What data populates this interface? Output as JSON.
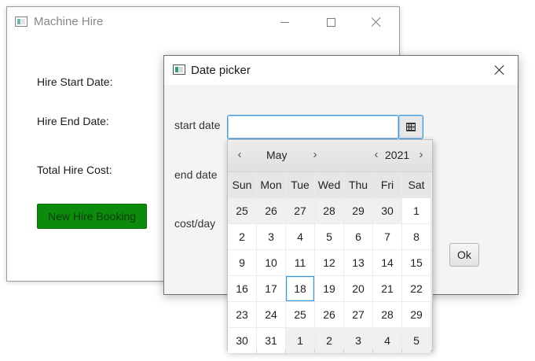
{
  "main_window": {
    "title": "Machine Hire",
    "labels": {
      "hire_start": "Hire Start Date:",
      "hire_end": "Hire End Date:",
      "total_cost": "Total Hire Cost:"
    },
    "new_booking_button": "New Hire Booking",
    "button_color": "#0b8a0b"
  },
  "dialog": {
    "title": "Date picker",
    "start_label": "start date",
    "end_label": "end date",
    "cost_label": "cost/day",
    "start_value": "",
    "ok_button": "Ok",
    "focus_color": "#3a9ad9"
  },
  "picker": {
    "month": "May",
    "year": "2021",
    "today": "18",
    "weekdays": [
      "Sun",
      "Mon",
      "Tue",
      "Wed",
      "Thu",
      "Fri",
      "Sat"
    ],
    "weeks": [
      [
        "25",
        "26",
        "27",
        "28",
        "29",
        "30",
        "1"
      ],
      [
        "2",
        "3",
        "4",
        "5",
        "6",
        "7",
        "8"
      ],
      [
        "9",
        "10",
        "11",
        "12",
        "13",
        "14",
        "15"
      ],
      [
        "16",
        "17",
        "18",
        "19",
        "20",
        "21",
        "22"
      ],
      [
        "23",
        "24",
        "25",
        "26",
        "27",
        "28",
        "29"
      ],
      [
        "30",
        "31",
        "1",
        "2",
        "3",
        "4",
        "5"
      ]
    ]
  }
}
